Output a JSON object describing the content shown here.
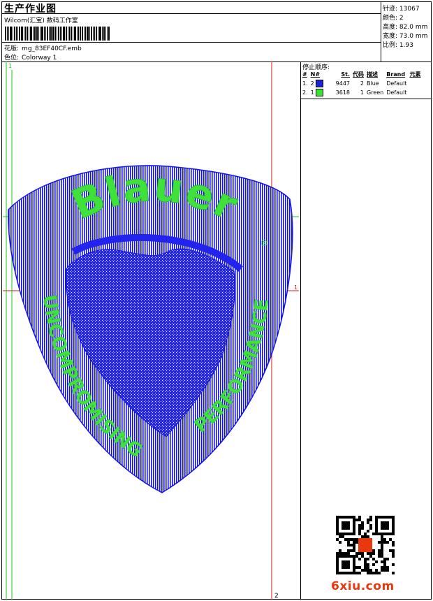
{
  "header": {
    "title": "生产作业图",
    "subtitle": "Wilcom(汇宝) 数码工作室",
    "design_label": "花版:",
    "design_value": "mg_83EF40CF.emb",
    "colorway_label": "色位:",
    "colorway_value": "Colorway 1"
  },
  "stats": [
    {
      "label": "针迹:",
      "value": "13067"
    },
    {
      "label": "颜色:",
      "value": "2"
    },
    {
      "label": "高度:",
      "value": "82.0 mm"
    },
    {
      "label": "宽度:",
      "value": "73.0 mm"
    },
    {
      "label": "比例:",
      "value": "1.93"
    }
  ],
  "stop_sequence": {
    "title": "停止顺序:",
    "columns": [
      "#",
      "N#",
      "St.",
      "代码",
      "描述",
      "Brand",
      "元素"
    ],
    "rows": [
      {
        "index": "1.",
        "n": "2",
        "color": "#1f1fe0",
        "stitches": "9447",
        "code": "2",
        "description": "Blue",
        "brand": "Default"
      },
      {
        "index": "2.",
        "n": "1",
        "color": "#33e82c",
        "stitches": "3618",
        "code": "1",
        "description": "Green",
        "brand": "Default"
      }
    ]
  },
  "design": {
    "guide_labels": {
      "left_top": "1",
      "right_mid": "1",
      "bottom": "2"
    },
    "brand_text": "Blauer",
    "registered_mark": "®",
    "left_arc_text": "UNCOMPROMISING",
    "right_arc_text": "PERFORMANCE",
    "shield_color": "#1414e6",
    "text_color": "#3fe23a",
    "guide_color": "#e01515",
    "guide_green": "#19c419"
  },
  "watermark": "6xiu.com"
}
